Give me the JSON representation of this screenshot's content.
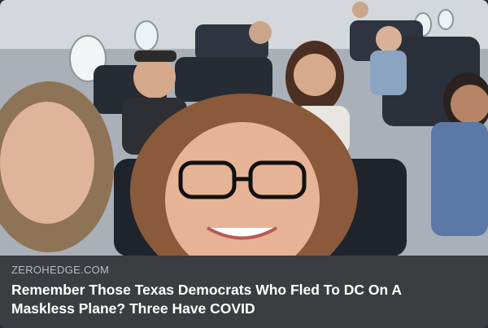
{
  "card": {
    "source": "ZEROHEDGE.COM",
    "headline": "Remember Those Texas Democrats Who Fled To DC On A Maskless Plane? Three Have COVID"
  },
  "photo": {
    "icon": "photo-image"
  }
}
